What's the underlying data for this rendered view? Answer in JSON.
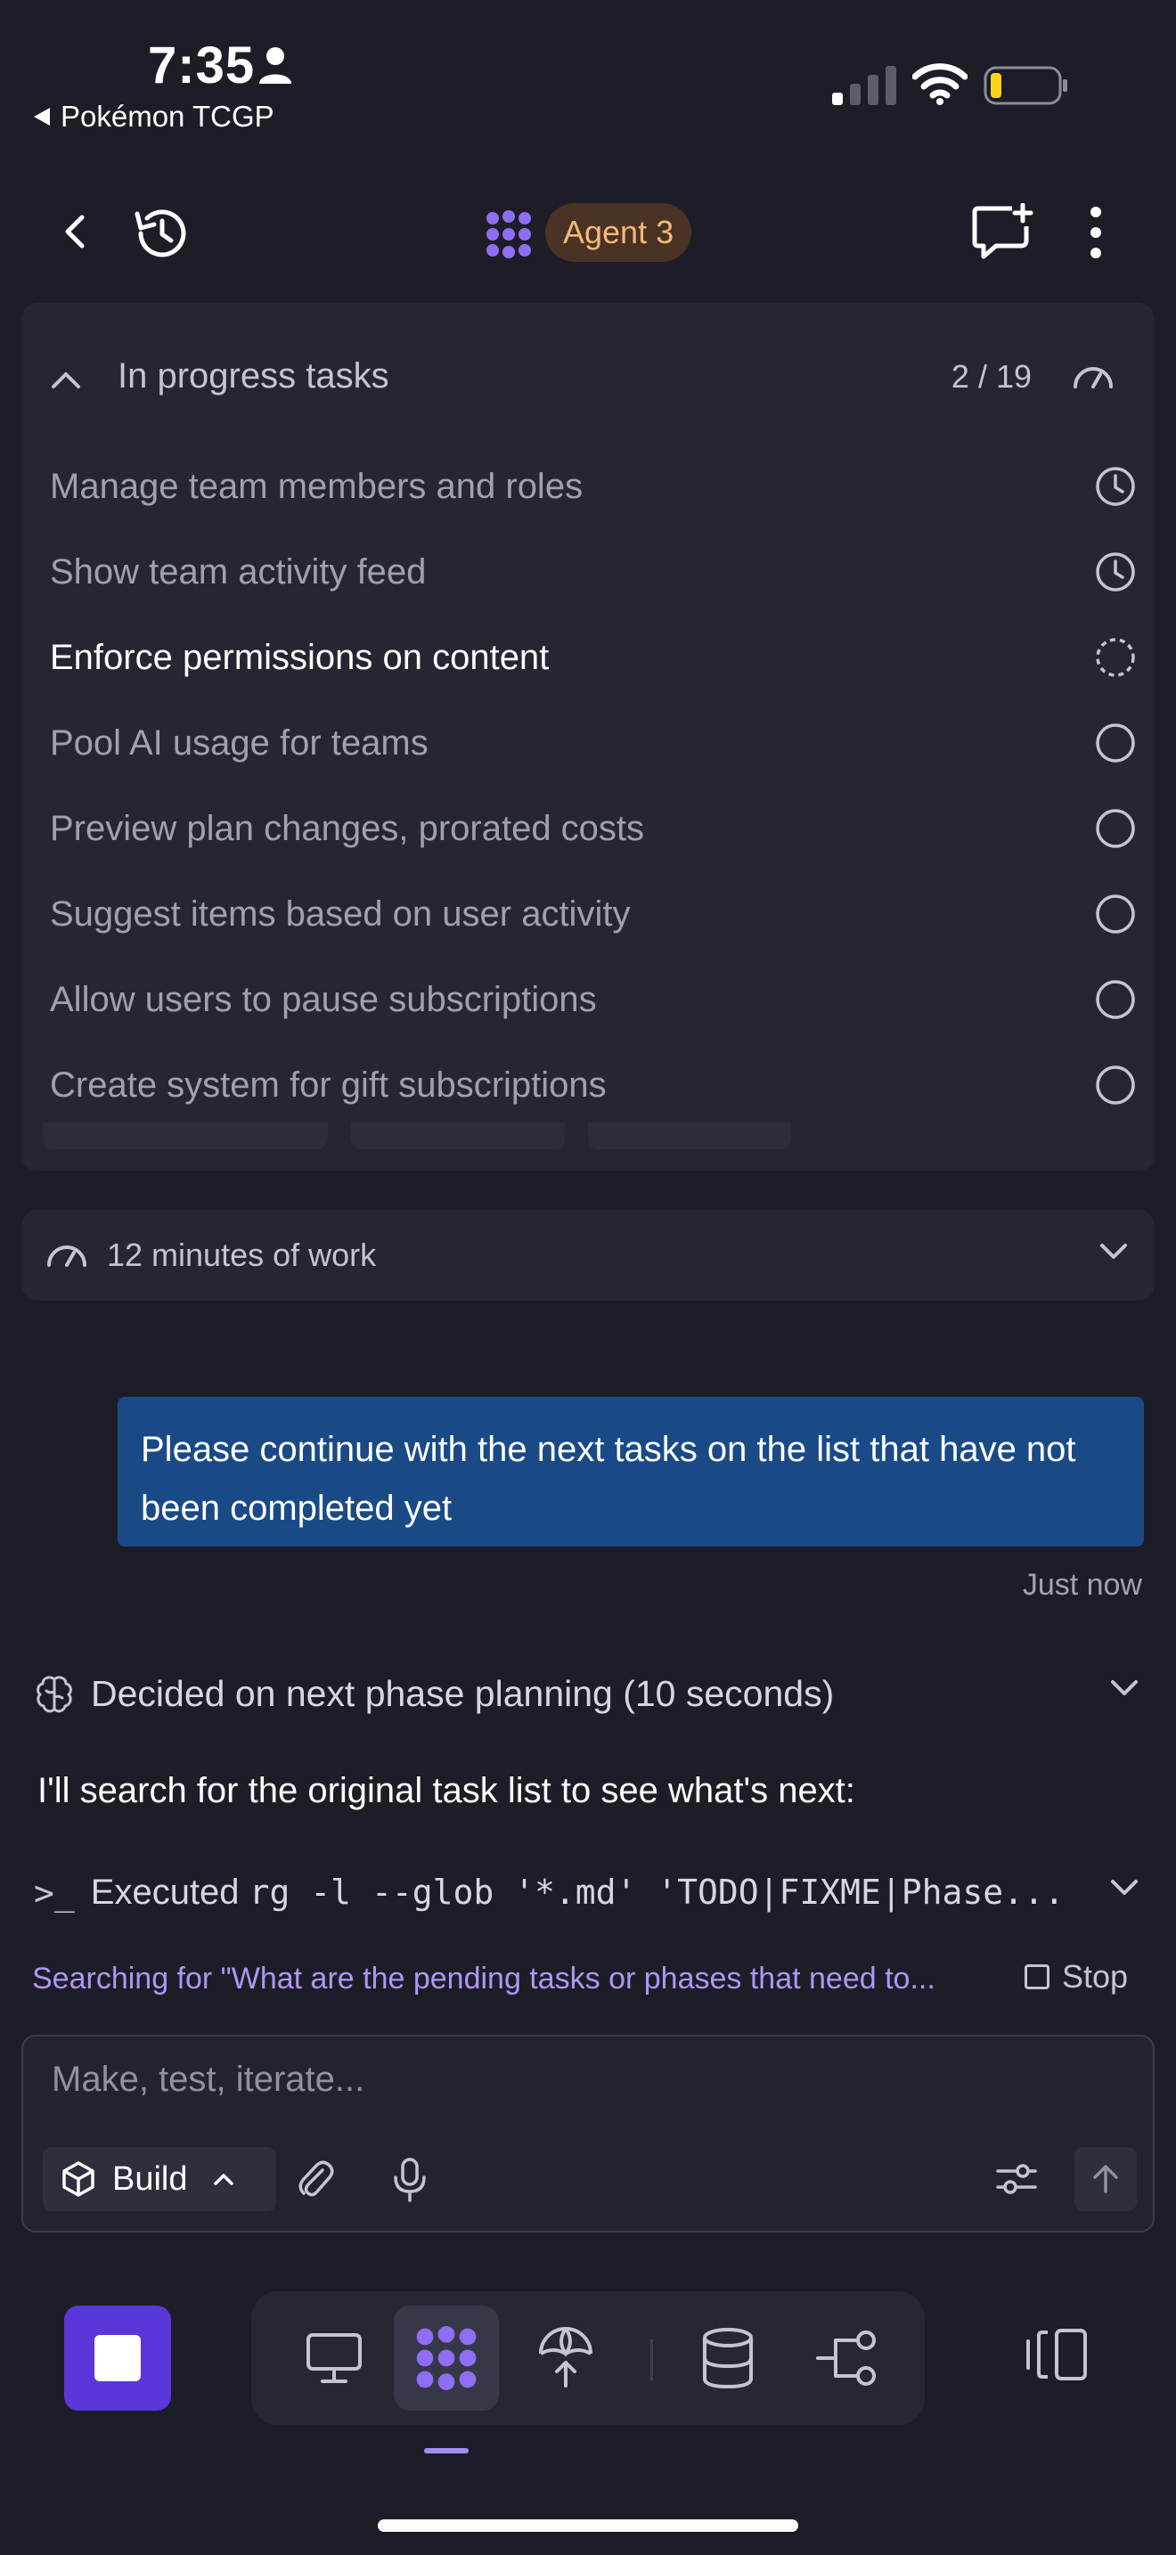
{
  "status_bar": {
    "time": "7:35",
    "back_app": "Pokémon TCGP"
  },
  "header": {
    "agent_label": "Agent 3"
  },
  "tasks": {
    "title": "In progress tasks",
    "count": "2 / 19",
    "items": [
      {
        "label": "Manage team members and roles",
        "status": "scheduled-icon"
      },
      {
        "label": "Show team activity feed",
        "status": "scheduled-icon"
      },
      {
        "label": "Enforce permissions on content",
        "status": "in-progress-icon"
      },
      {
        "label": "Pool AI usage for teams",
        "status": "pending-icon"
      },
      {
        "label": "Preview plan changes, prorated costs",
        "status": "pending-icon"
      },
      {
        "label": "Suggest items based on user activity",
        "status": "pending-icon"
      },
      {
        "label": "Allow users to pause subscriptions",
        "status": "pending-icon"
      },
      {
        "label": "Create system for gift subscriptions",
        "status": "pending-icon"
      }
    ]
  },
  "work_summary": "12 minutes of work",
  "chat": {
    "user_message": "Please continue with the next tasks on the list that have not been completed yet",
    "user_message_time": "Just now",
    "thought": "Decided on next phase planning (10 seconds)",
    "agent_text": "I'll search for the original task list to see what's next:",
    "exec_prompt": ">_",
    "exec_label": "Executed",
    "exec_command": "rg -l --glob '*.md' 'TODO|FIXME|Phase...",
    "search_status": "Searching for \"What are the pending tasks or phases that need to...",
    "stop_label": "Stop"
  },
  "composer": {
    "placeholder": "Make, test, iterate...",
    "mode_label": "Build"
  },
  "colors": {
    "background": "#1c1d27",
    "accent": "#5a37d8",
    "user_bubble": "#1a4a86",
    "agent_pill_bg": "#4a3325",
    "agent_pill_text": "#f5b878",
    "search_status": "#b195f5"
  }
}
